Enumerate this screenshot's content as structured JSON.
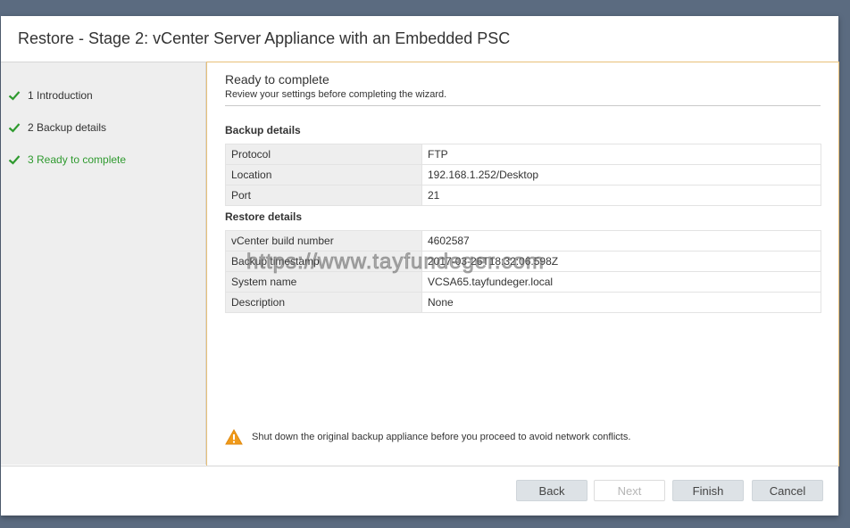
{
  "dialog": {
    "title": "Restore - Stage 2: vCenter Server Appliance with an Embedded PSC"
  },
  "steps": [
    {
      "label": "1 Introduction",
      "done": true
    },
    {
      "label": "2 Backup details",
      "done": true
    },
    {
      "label": "3 Ready to complete",
      "done": true,
      "active": true
    }
  ],
  "content": {
    "heading": "Ready to complete",
    "subheading": "Review your settings before completing the wizard.",
    "backup_section": {
      "title": "Backup details",
      "rows": [
        {
          "key": "Protocol",
          "value": "FTP"
        },
        {
          "key": "Location",
          "value": "192.168.1.252/Desktop"
        },
        {
          "key": "Port",
          "value": "21"
        }
      ]
    },
    "restore_section": {
      "title": "Restore details",
      "rows": [
        {
          "key": "vCenter build number",
          "value": "4602587"
        },
        {
          "key": "Backup timestamp",
          "value": "2017-03-26T18:32:06.598Z"
        },
        {
          "key": "System name",
          "value": "VCSA65.tayfundeger.local"
        },
        {
          "key": "Description",
          "value": "None"
        }
      ]
    },
    "warning": "Shut down the original backup appliance before you proceed to avoid network conflicts."
  },
  "watermark": "https://www.tayfundeger.com",
  "buttons": {
    "back": "Back",
    "next": "Next",
    "finish": "Finish",
    "cancel": "Cancel"
  },
  "colors": {
    "accent_border": "#e8c078",
    "check_green": "#2f9a2f",
    "warning_orange": "#f09a1a",
    "button_bg": "#dde2e6"
  }
}
